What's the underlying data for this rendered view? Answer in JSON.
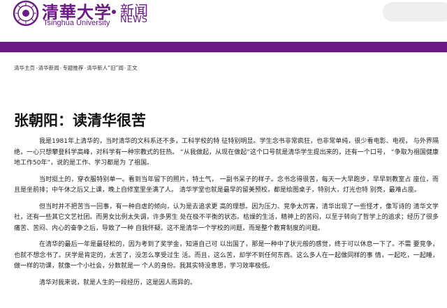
{
  "header": {
    "logo_cn": "清華大学",
    "logo_en": "Tsinghua University",
    "section_cn": "新闻",
    "section_en": "NEWS"
  },
  "breadcrumb": {
    "items": [
      "清华主页",
      "清华新闻",
      "专题推荐",
      "清华新人“旧”闻",
      "正文"
    ],
    "separator": "-"
  },
  "article": {
    "title": "张朝阳：读清华很苦",
    "paragraphs": [
      "我是1981年上清华的，当时清华的文科系还不多，工科学校的特 征特别明显。学生念书非常疯狂，也非常单纯，很少看电影、电视， 与外界隔绝，一心只想攀登科学高峰，对科学有一种宗教式的狂热。 “从我做起，从现在做起”这个口号就是清华学生提出来的，还有一个口号， “争取为祖国健康地工作50年”，说的是工作、学习都是为 了祖国。",
      "当时挺土的，穿衣服特别单一。看到当年留下的照片，特土气， 一副书呆子的样子。念书念得很苦，每天一大早跑步，早早到教室占 座位，而且是坐前排；中午休之后又上课，晚上自修室里坐满了人。 清华学堂也就是最早的留美预校，都是绘图桌子，特别大，灯光也特 别亮，最难占座。",
      "但当时并不把苦当一回事，有一种自虐的倾向，认为是去追求更 高的理想。因为压力、竞争太厉害，清华出现了一些怪才，像写诗的 清华文学社，还有一些其它文艺社团。而男女比例太失调，许多男生 处在极不平衡的状态。枯燥的生活，精神上的苦闷，以至于转向了哲学上的追求；经历了很多痛苦、苦闷、内心的奋争之后，导致了一种 自我怀疑。这不是清华一个学校的问题，而是整个教育制度的问题。",
      "在清华的最后一年是最轻松的，因为考到了奖学金，知道自己可 以出国了，那是一种中了状元般的感觉，终于可以休息一下了。不需 要竞争，也就不想念书了。厌学是肯定的，太苦了，没怎么享受过生 活。而且，这么苦，却学不到任何东西。这么多人在一起做同样的事 情，一起吃，一起睡，做一样的功课，就像一个小社会，分数就是一 个人的身份。我其实特没意思，学习效率极低。",
      "清华对我来说，就是人生的一段经历，这是因人而异的。"
    ]
  },
  "colors": {
    "brand_purple": "#6a1985",
    "search_bg": "#efefef"
  },
  "icons": {
    "seal": "tsinghua-seal-icon"
  }
}
